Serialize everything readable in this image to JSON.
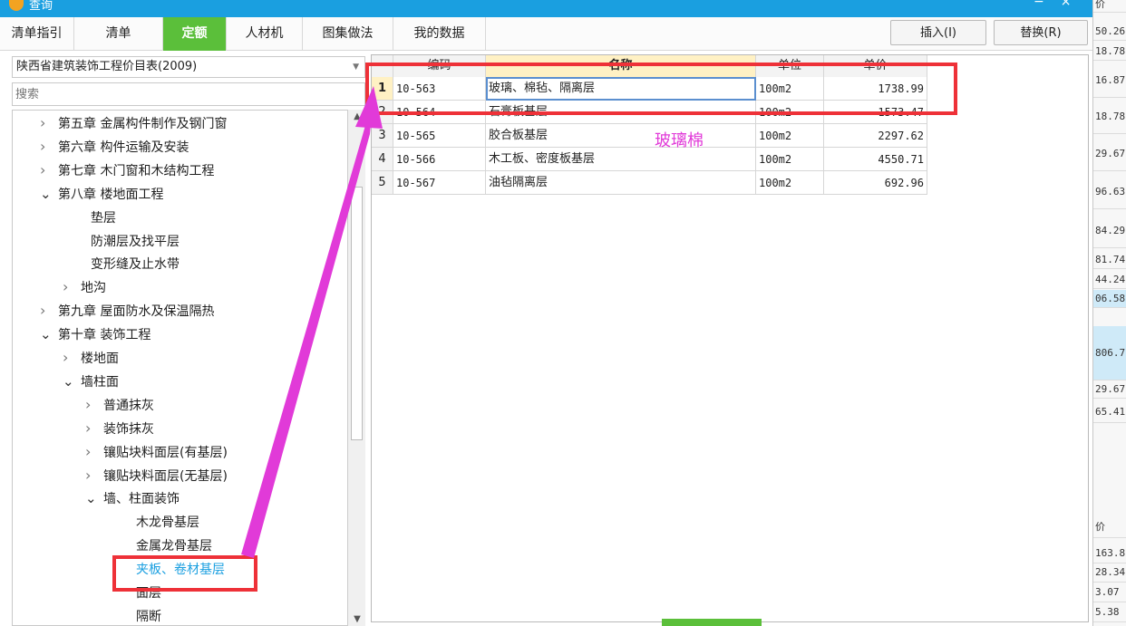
{
  "window": {
    "title": "查询"
  },
  "tabs": [
    {
      "label": "清单指引",
      "active": false
    },
    {
      "label": "清单",
      "active": false
    },
    {
      "label": "定额",
      "active": true
    },
    {
      "label": "人材机",
      "active": false
    },
    {
      "label": "图集做法",
      "active": false
    },
    {
      "label": "我的数据",
      "active": false
    }
  ],
  "toolbar": {
    "insert_label": "插入(I)",
    "replace_label": "替换(R)"
  },
  "library_select": {
    "value": "陕西省建筑装饰工程价目表(2009)"
  },
  "search": {
    "placeholder": "搜索"
  },
  "tree": [
    {
      "label": "第五章 金属构件制作及钢门窗",
      "state": "collapsed"
    },
    {
      "label": "第六章 构件运输及安装",
      "state": "collapsed"
    },
    {
      "label": "第七章 木门窗和木结构工程",
      "state": "collapsed"
    },
    {
      "label": "第八章 楼地面工程",
      "state": "expanded"
    },
    {
      "label": "垫层",
      "state": "leaf"
    },
    {
      "label": "防潮层及找平层",
      "state": "leaf"
    },
    {
      "label": "变形缝及止水带",
      "state": "leaf"
    },
    {
      "label": "地沟",
      "state": "collapsed"
    },
    {
      "label": "第九章 屋面防水及保温隔热",
      "state": "collapsed"
    },
    {
      "label": "第十章 装饰工程",
      "state": "expanded"
    },
    {
      "label": "楼地面",
      "state": "collapsed"
    },
    {
      "label": "墙柱面",
      "state": "expanded"
    },
    {
      "label": "普通抹灰",
      "state": "collapsed"
    },
    {
      "label": "装饰抹灰",
      "state": "collapsed"
    },
    {
      "label": "镶贴块料面层(有基层)",
      "state": "collapsed"
    },
    {
      "label": "镶贴块料面层(无基层)",
      "state": "collapsed"
    },
    {
      "label": "墙、柱面装饰",
      "state": "expanded"
    },
    {
      "label": "木龙骨基层",
      "state": "leaf"
    },
    {
      "label": "金属龙骨基层",
      "state": "leaf"
    },
    {
      "label": "夹板、卷材基层",
      "state": "selected"
    },
    {
      "label": "面层",
      "state": "leaf"
    },
    {
      "label": "隔断",
      "state": "leaf"
    }
  ],
  "table": {
    "headers": [
      "",
      "编码",
      "名称",
      "单位",
      "单价"
    ],
    "rows": [
      {
        "num": "1",
        "code": "10-563",
        "name": "玻璃、棉毡、隔离层",
        "unit": "100m2",
        "price": "1738.99"
      },
      {
        "num": "2",
        "code": "10-564",
        "name": "石膏板基层",
        "unit": "100m2",
        "price": "1573.47"
      },
      {
        "num": "3",
        "code": "10-565",
        "name": "胶合板基层",
        "unit": "100m2",
        "price": "2297.62"
      },
      {
        "num": "4",
        "code": "10-566",
        "name": "木工板、密度板基层",
        "unit": "100m2",
        "price": "4550.71"
      },
      {
        "num": "5",
        "code": "10-567",
        "name": "油毡隔离层",
        "unit": "100m2",
        "price": "692.96"
      }
    ]
  },
  "annotation": {
    "label": "玻璃棉"
  },
  "background_right": {
    "header": "价",
    "values": [
      "50.26",
      "18.78",
      "16.87",
      "18.78",
      "29.67",
      "96.63",
      "84.29",
      "81.74",
      "44.24",
      "06.58",
      "806.7",
      "29.67",
      "65.41"
    ],
    "header2": "价",
    "values2": [
      "163.8",
      "28.34",
      "3.07",
      "5.38"
    ]
  },
  "colors": {
    "accent_green": "#5bbf3a",
    "title_blue": "#1a9fe0",
    "annotation_red": "#ee3138",
    "annotation_magenta": "#e13ad8"
  }
}
